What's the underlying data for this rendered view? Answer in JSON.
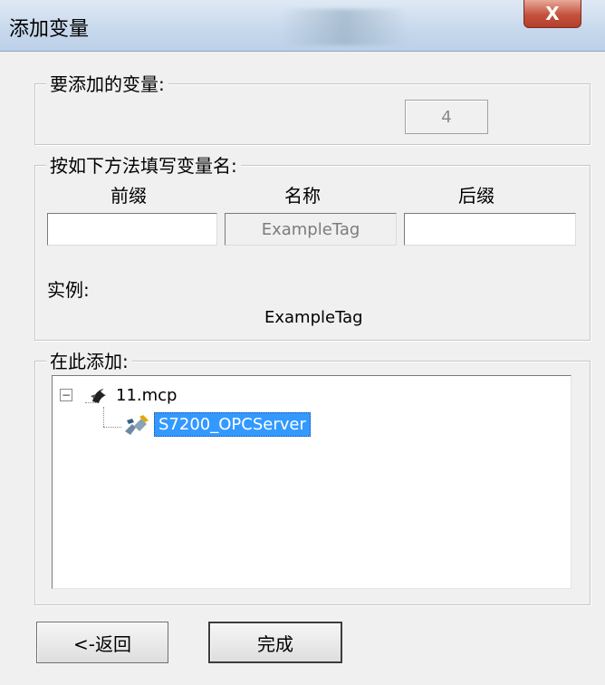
{
  "window": {
    "title": "添加变量",
    "close_label": "X"
  },
  "count_group": {
    "label": "要添加的变量:",
    "count": "4"
  },
  "naming_group": {
    "label": "按如下方法填写变量名:",
    "columns": {
      "prefix": "前缀",
      "name": "名称",
      "suffix": "后缀"
    },
    "fields": {
      "prefix": "",
      "name": "ExampleTag",
      "suffix": ""
    },
    "example_label": "实例:",
    "example_value": "ExampleTag"
  },
  "location_group": {
    "label": "在此添加:",
    "tree": {
      "root": {
        "label": "11.mcp",
        "expander": "−",
        "icon": "project-icon"
      },
      "child": {
        "label": "S7200_OPCServer",
        "icon": "server-icon",
        "selected": true
      }
    }
  },
  "buttons": {
    "back": "<-返回",
    "finish": "完成"
  }
}
